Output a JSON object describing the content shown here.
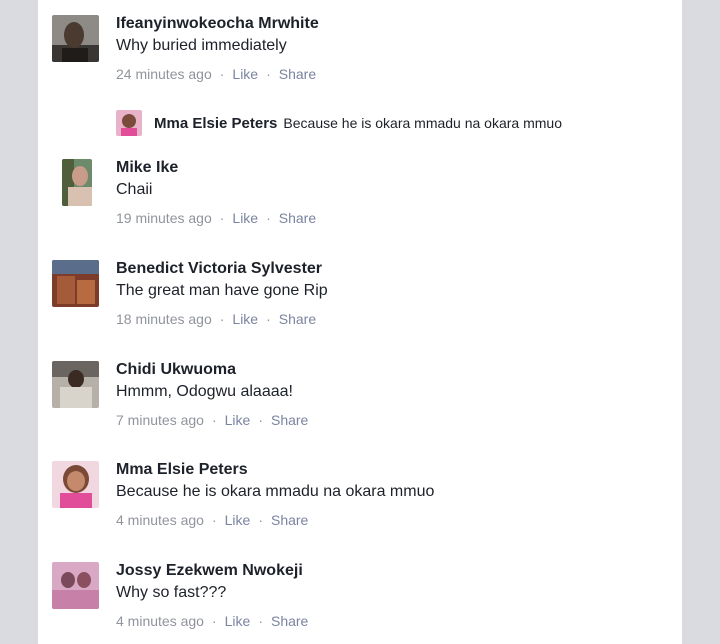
{
  "comments": [
    {
      "name": "Ifeanyinwokeocha Mrwhite",
      "text": "Why buried immediately",
      "time": "24 minutes ago",
      "like": "Like",
      "share": "Share"
    },
    {
      "name": "Mike Ike",
      "text": "Chaii",
      "time": "19 minutes ago",
      "like": "Like",
      "share": "Share"
    },
    {
      "name": "Benedict Victoria Sylvester",
      "text": "The great  man have gone Rip",
      "time": "18 minutes ago",
      "like": "Like",
      "share": "Share"
    },
    {
      "name": "Chidi Ukwuoma",
      "text": "Hmmm, Odogwu alaaaa!",
      "time": "7 minutes ago",
      "like": "Like",
      "share": "Share"
    },
    {
      "name": "Mma Elsie Peters",
      "text": "Because he is okara mmadu na okara mmuo",
      "time": "4 minutes ago",
      "like": "Like",
      "share": "Share"
    },
    {
      "name": "Jossy Ezekwem Nwokeji",
      "text": "Why so fast???",
      "time": "4 minutes ago",
      "like": "Like",
      "share": "Share"
    }
  ],
  "reply": {
    "name": "Mma Elsie Peters",
    "text": "Because he is okara mmadu na okara mmuo"
  },
  "separator": "·"
}
